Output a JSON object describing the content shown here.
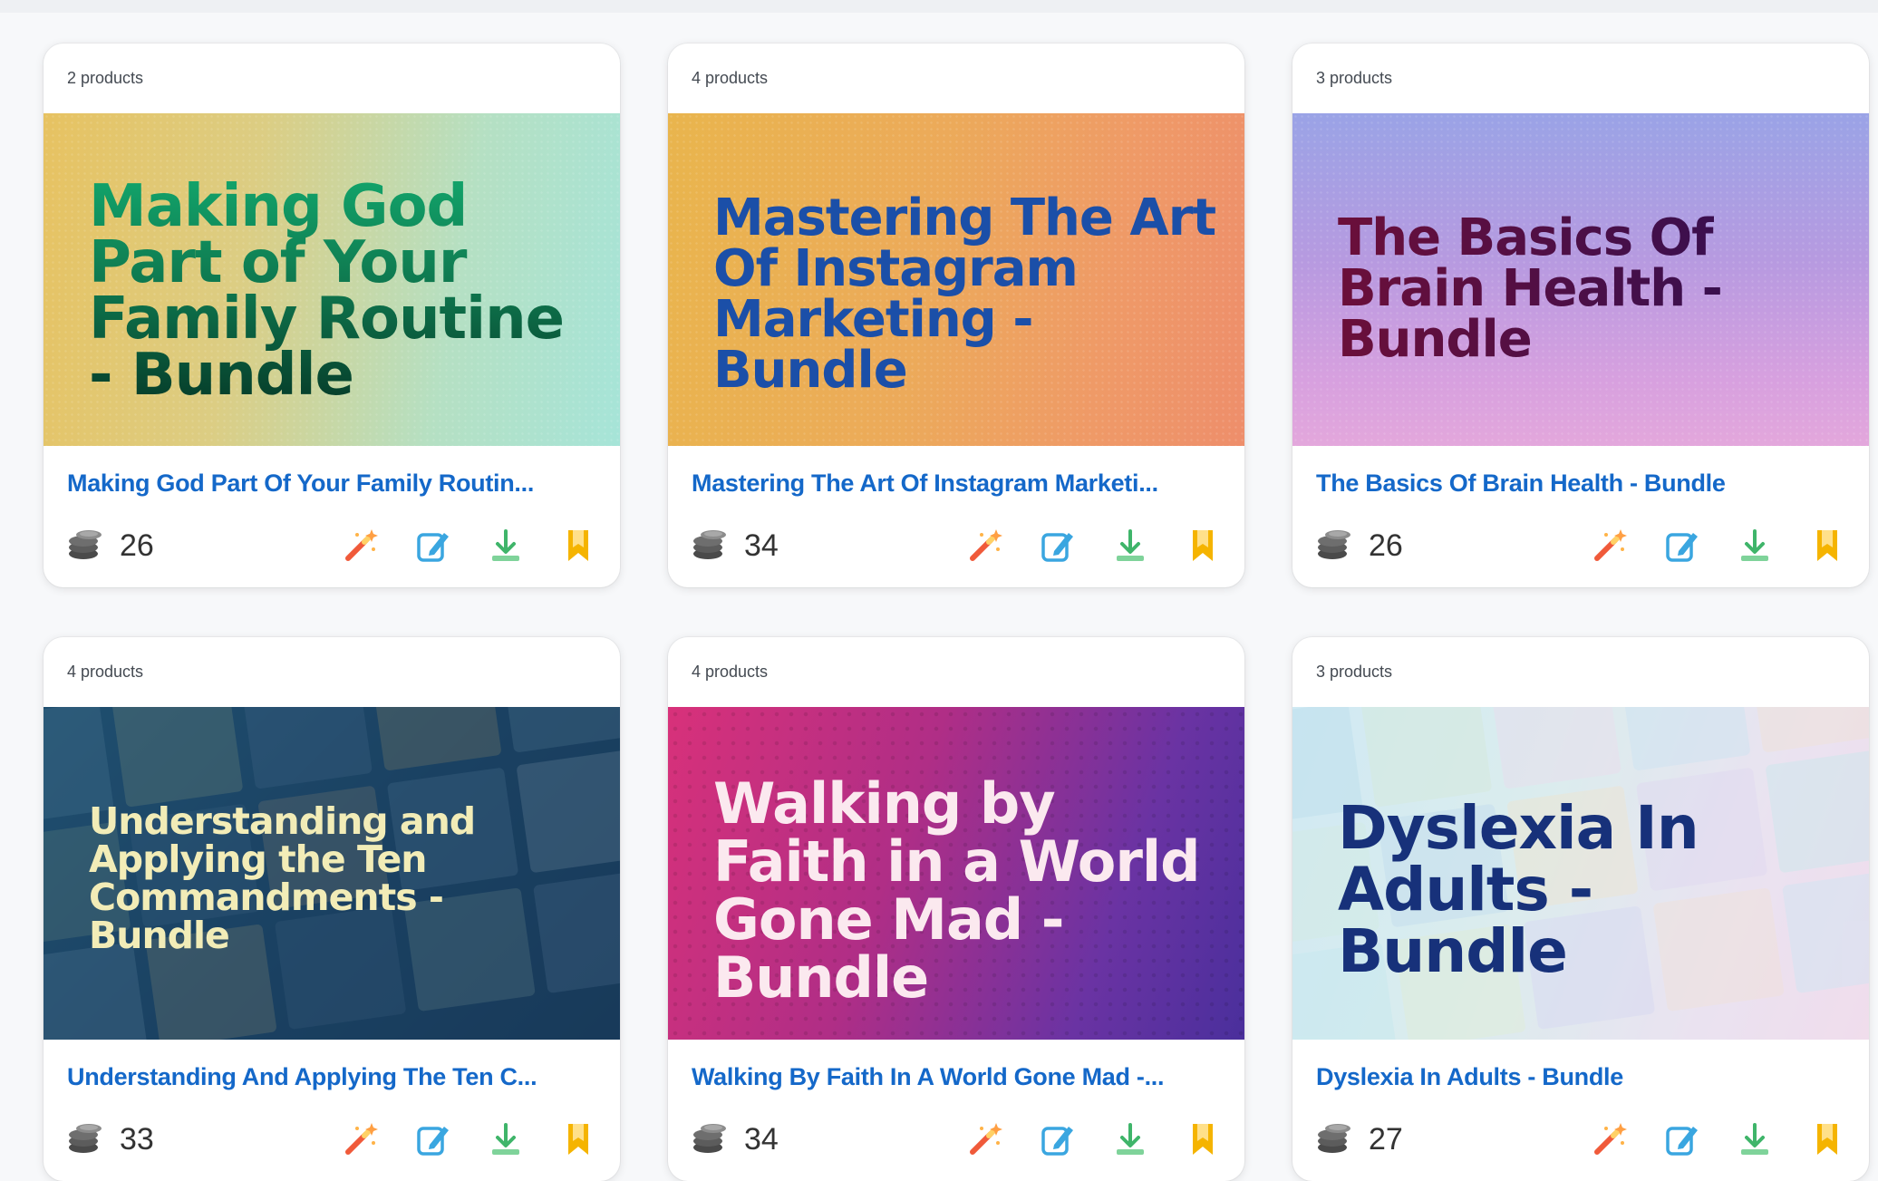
{
  "cards": [
    {
      "products": "2 products",
      "thumb_title": "Making God Part of Your Family Routine - Bundle",
      "title": "Making God Part Of Your Family Routin...",
      "count": "26"
    },
    {
      "products": "4 products",
      "thumb_title": "Mastering The Art Of Instagram Marketing - Bundle",
      "title": "Mastering The Art Of Instagram Marketi...",
      "count": "34"
    },
    {
      "products": "3 products",
      "thumb_title": "The Basics Of Brain Health - Bundle",
      "title": "The Basics Of Brain Health - Bundle",
      "count": "26"
    },
    {
      "products": "4 products",
      "thumb_title": "Understanding and Applying the Ten Commandments - Bundle",
      "title": "Understanding And Applying The Ten C...",
      "count": "33"
    },
    {
      "products": "4 products",
      "thumb_title": "Walking by Faith in a World Gone Mad - Bundle",
      "title": "Walking By Faith In A World Gone Mad -...",
      "count": "34"
    },
    {
      "products": "3 products",
      "thumb_title": "Dyslexia In Adults - Bundle",
      "title": "Dyslexia In Adults - Bundle",
      "count": "27"
    }
  ],
  "icons": {
    "credits": "coins-stack-icon",
    "actions": [
      "magic-wand-icon",
      "edit-icon",
      "download-icon",
      "bookmark-icon"
    ]
  },
  "colors": {
    "title_link": "#1468c9",
    "magic": "#f05a3a",
    "edit": "#3aa6e0",
    "download": "#3fb56a",
    "bookmark": "#f5b400"
  }
}
